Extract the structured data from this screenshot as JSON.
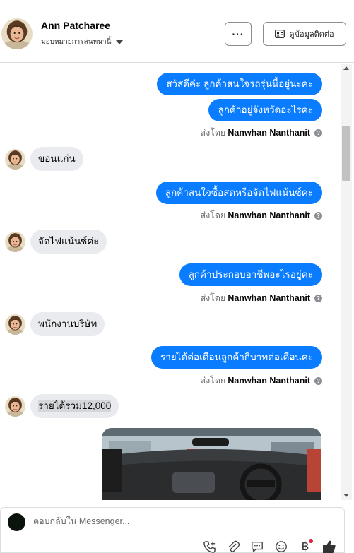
{
  "header": {
    "contact_name": "Ann Patcharee",
    "assigned_label": "มอบหมายการสนทนานี้",
    "more_label": "···",
    "view_contact_label": "ดูข้อมูลติดต่อ"
  },
  "messages": [
    {
      "type": "out",
      "text": "สวัสดีค่ะ ลูกค้าสนใจรถรุ่นนี้อยู่นะคะ"
    },
    {
      "type": "out",
      "text": "ลูกค้าอยู่จังหวัดอะไรคะ"
    },
    {
      "type": "sent_by",
      "prefix": "ส่งโดย",
      "agent": "Nanwhan Nanthanit"
    },
    {
      "type": "in",
      "text": "ขอนแก่น"
    },
    {
      "type": "out",
      "text": "ลูกค้าสนใจซื้อสดหรือจัดไฟแน้นซ์คะ"
    },
    {
      "type": "sent_by",
      "prefix": "ส่งโดย",
      "agent": "Nanwhan Nanthanit"
    },
    {
      "type": "in",
      "text": "จัดไฟแน้นซ์ค่ะ"
    },
    {
      "type": "out",
      "text": "ลูกค้าประกอบอาชีพอะไรอยู่คะ"
    },
    {
      "type": "sent_by",
      "prefix": "ส่งโดย",
      "agent": "Nanwhan Nanthanit"
    },
    {
      "type": "in",
      "text": "พนักงานบริษัท"
    },
    {
      "type": "out",
      "text": "รายได้ต่อเดือนลูกค้ากี่บาทต่อเดือนคะ"
    },
    {
      "type": "sent_by",
      "prefix": "ส่งโดย",
      "agent": "Nanwhan Nanthanit"
    },
    {
      "type": "in",
      "text": "รายได้รวม12,000"
    }
  ],
  "composer": {
    "placeholder": "ตอบกลับใน Messenger...",
    "icons": [
      "add-call-icon",
      "attachment-icon",
      "saved-reply-icon",
      "emoji-icon",
      "baht-payment-icon",
      "like-icon"
    ],
    "baht_symbol": "฿"
  },
  "colors": {
    "outgoing_bubble": "#0a7cff",
    "incoming_bubble": "#e9ebee",
    "notification_dot": "#e41e3f"
  }
}
